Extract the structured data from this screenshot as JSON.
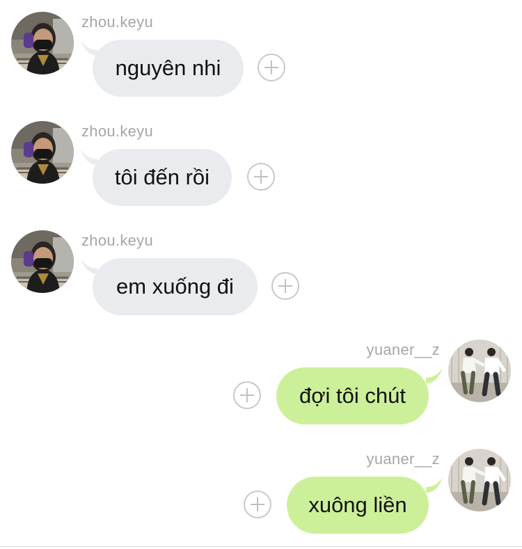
{
  "colors": {
    "incoming_bubble": "#e9ebef",
    "outgoing_bubble": "#ccf099",
    "sender_name": "#a6a6a6",
    "message_text": "#111111",
    "plus_icon": "#c0c0c0"
  },
  "messages": [
    {
      "sender": "zhou.keyu",
      "text": "nguyên nhi",
      "direction": "incoming",
      "avatar": "avatar-masked-person-icon",
      "action": "add-reaction-icon"
    },
    {
      "sender": "zhou.keyu",
      "text": "tôi đến rồi",
      "direction": "incoming",
      "avatar": "avatar-masked-person-icon",
      "action": "add-reaction-icon"
    },
    {
      "sender": "zhou.keyu",
      "text": "em xuống đi",
      "direction": "incoming",
      "avatar": "avatar-masked-person-icon",
      "action": "add-reaction-icon"
    },
    {
      "sender": "yuaner__z",
      "text": "đợi tôi chút",
      "direction": "outgoing",
      "avatar": "avatar-two-dancers-icon",
      "action": "add-reaction-icon"
    },
    {
      "sender": "yuaner__z",
      "text": "xuông liền",
      "direction": "outgoing",
      "avatar": "avatar-two-dancers-icon",
      "action": "add-reaction-icon"
    }
  ]
}
